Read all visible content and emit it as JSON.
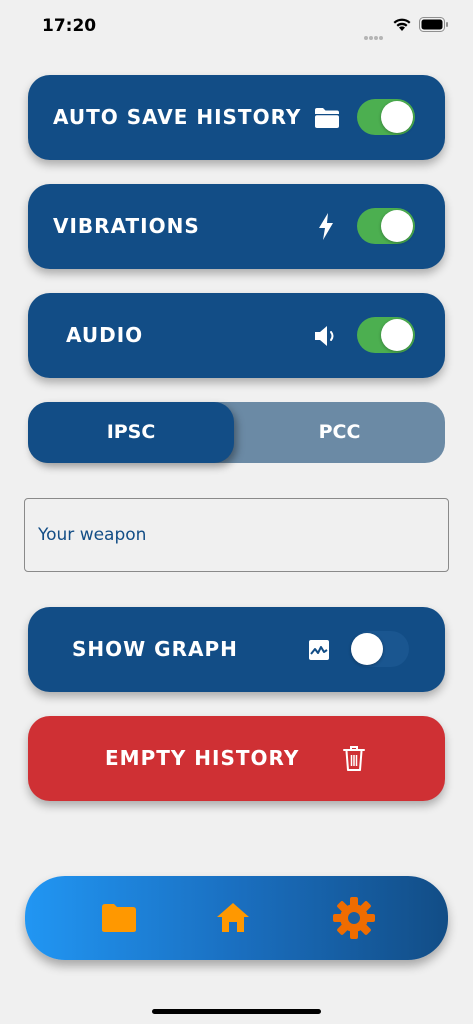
{
  "status": {
    "time": "17:20"
  },
  "settings": {
    "auto_save": {
      "label": "AUTO SAVE HISTORY",
      "icon": "folder-icon",
      "enabled": true
    },
    "vibrations": {
      "label": "VIBRATIONS",
      "icon": "lightning-icon",
      "enabled": true
    },
    "audio": {
      "label": "AUDIO",
      "icon": "speaker-icon",
      "enabled": true
    },
    "show_graph": {
      "label": "SHOW GRAPH",
      "icon": "graph-icon",
      "enabled": false
    }
  },
  "discipline": {
    "options": [
      "IPSC",
      "PCC"
    ],
    "selected": "IPSC"
  },
  "weapon": {
    "placeholder": "Your weapon",
    "value": ""
  },
  "empty_history": {
    "label": "EMPTY HISTORY",
    "icon": "trash-icon"
  },
  "nav": {
    "items": [
      {
        "icon": "folder-icon",
        "active": false
      },
      {
        "icon": "home-icon",
        "active": false
      },
      {
        "icon": "gear-icon",
        "active": true
      }
    ]
  },
  "colors": {
    "card": "#124d86",
    "toggle_on": "#4caf50",
    "segment_inactive": "#6b8aa5",
    "danger": "#cf3034",
    "nav_icon": "#ff9800",
    "nav_icon_active": "#ef6c00"
  }
}
